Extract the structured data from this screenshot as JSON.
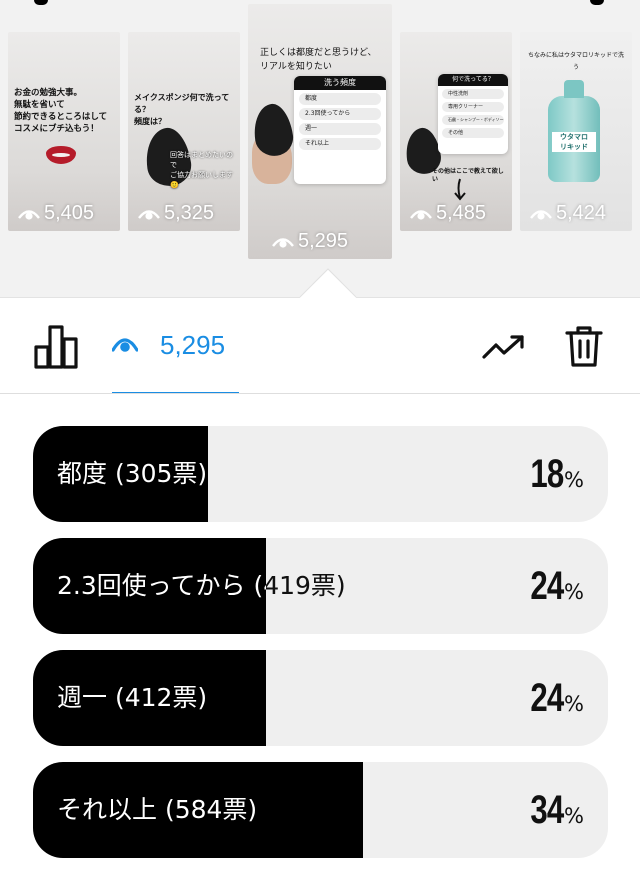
{
  "stories": [
    {
      "caption": "お金の勉強大事。\n無駄を省いて\n節約できるところはして\nコスメにブチ込もう！",
      "views": "5,405"
    },
    {
      "caption": "メイクスポンジ何で洗ってる？\n頻度は？",
      "sub": "回答はまとめたいので\nご協力お願いします🙂",
      "views": "5,325"
    },
    {
      "caption": "正しくは都度だと思うけど、\nリアルを知りたい",
      "poll_title": "洗う頻度",
      "poll_options": [
        "都度",
        "2.3回使ってから",
        "週一",
        "それ以上"
      ],
      "views": "5,295"
    },
    {
      "poll_title": "何で洗ってる？",
      "poll_options": [
        "中性洗剤",
        "専用クリーナー",
        "石鹸・シャンプー・ボディソープ",
        "その他"
      ],
      "caption": "その他はここで教えて欲しい",
      "views": "5,485"
    },
    {
      "caption": "ちなみに私はウタマロリキッドで洗う",
      "bottle_label": "ウタマロ\nリキッド",
      "views": "5,424"
    }
  ],
  "toolbar": {
    "insights_icon": "bar-chart-icon",
    "views_icon": "eye-icon",
    "views_count": "5,295",
    "trend_icon": "trending-up-icon",
    "delete_icon": "trash-icon"
  },
  "poll_results": [
    {
      "label": "都度 (305票)",
      "percent": "18",
      "sign": "%",
      "fraction": 0.18
    },
    {
      "label": "2.3回使ってから (419票)",
      "percent": "24",
      "sign": "%",
      "fraction": 0.24
    },
    {
      "label": "週一 (412票)",
      "percent": "24",
      "sign": "%",
      "fraction": 0.24
    },
    {
      "label": "それ以上 (584票)",
      "percent": "34",
      "sign": "%",
      "fraction": 0.34
    }
  ],
  "colors": {
    "accent": "#1a8de3",
    "bar_fill": "#000000",
    "bar_track": "#efefef"
  }
}
